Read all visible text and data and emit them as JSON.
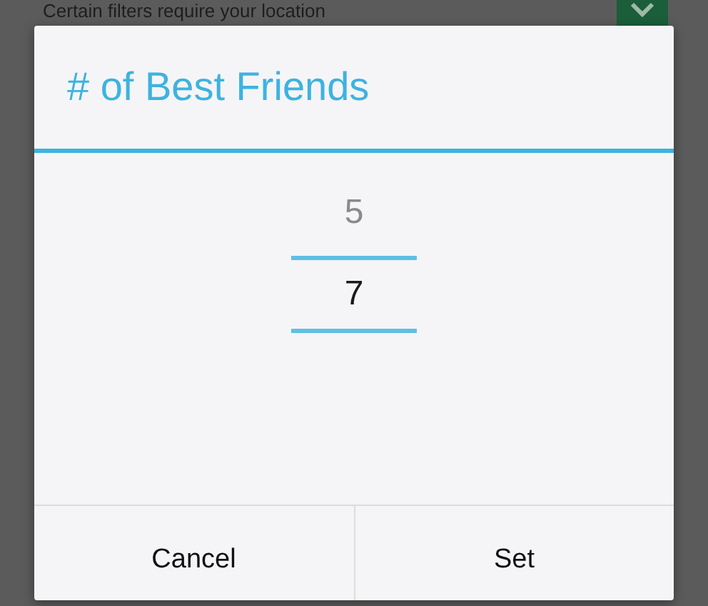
{
  "background": {
    "text": "Certain filters require your location"
  },
  "dialog": {
    "title": "# of Best Friends",
    "picker": [
      {
        "value": "5",
        "selected": false
      },
      {
        "value": "7",
        "selected": true
      }
    ],
    "buttons": [
      "Cancel",
      "Set"
    ]
  }
}
